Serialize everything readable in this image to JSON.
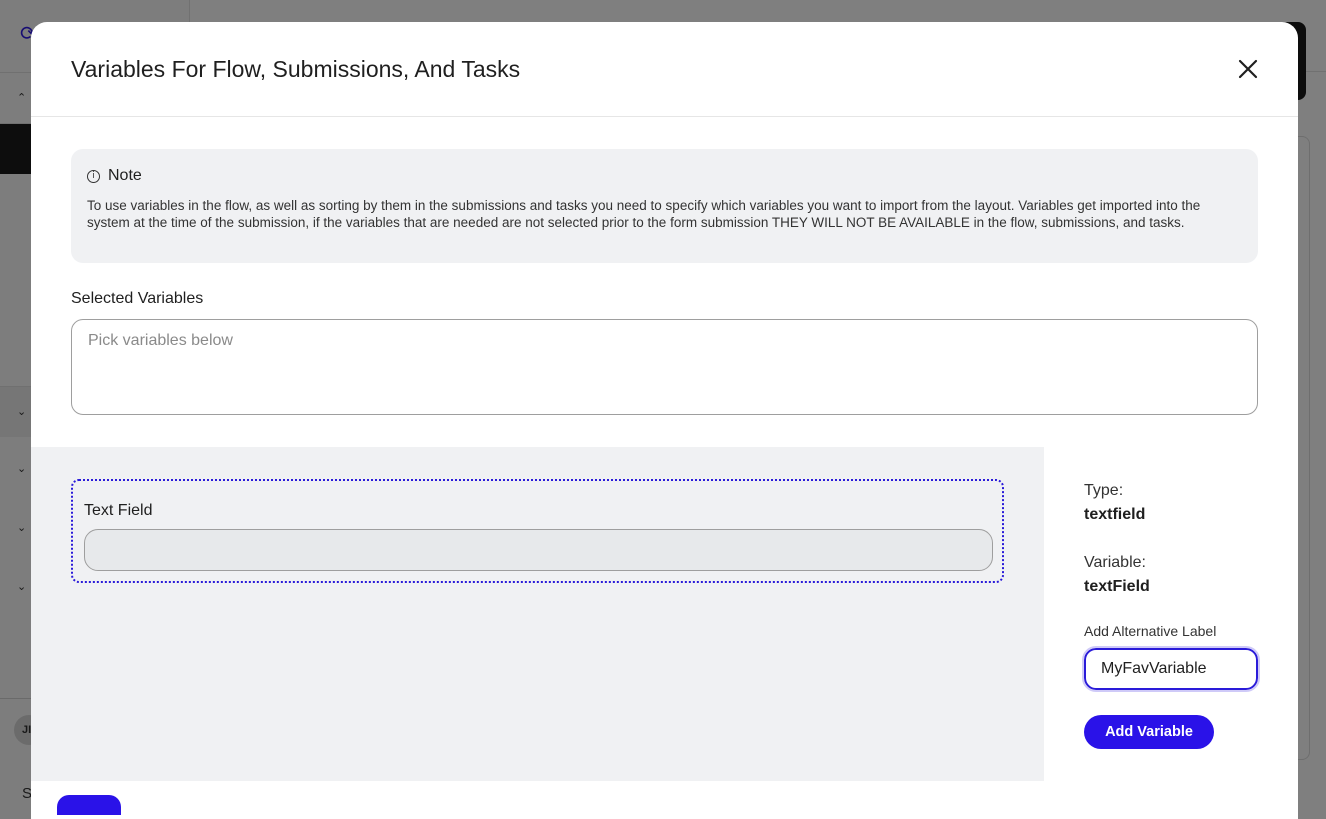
{
  "background": {
    "avatar_initials": "JI",
    "bottom_text": "S"
  },
  "modal": {
    "title": "Variables For Flow, Submissions, And Tasks",
    "close_icon": "close-icon"
  },
  "note": {
    "icon": "info-icon",
    "title": "Note",
    "text": "To use variables in the flow, as well as sorting by them in the submissions and tasks you need to specify which variables you want to import from the layout. Variables get imported into the system at the time of the submission, if the variables that are needed are not selected prior to the form submission THEY WILL NOT BE AVAILABLE in the flow, submissions, and tasks."
  },
  "selected": {
    "label": "Selected Variables",
    "placeholder": "Pick variables below"
  },
  "preview": {
    "field_label": "Text Field",
    "field_value": ""
  },
  "details": {
    "type_label": "Type:",
    "type_value": "textfield",
    "variable_label": "Variable:",
    "variable_value": "textField",
    "alt_label": "Add Alternative Label",
    "alt_value": "MyFavVariable",
    "add_button": "Add Variable"
  },
  "colors": {
    "accent": "#2a12e8",
    "note_bg": "#f0f1f3",
    "overlay": "rgba(0,0,0,0.5)"
  }
}
